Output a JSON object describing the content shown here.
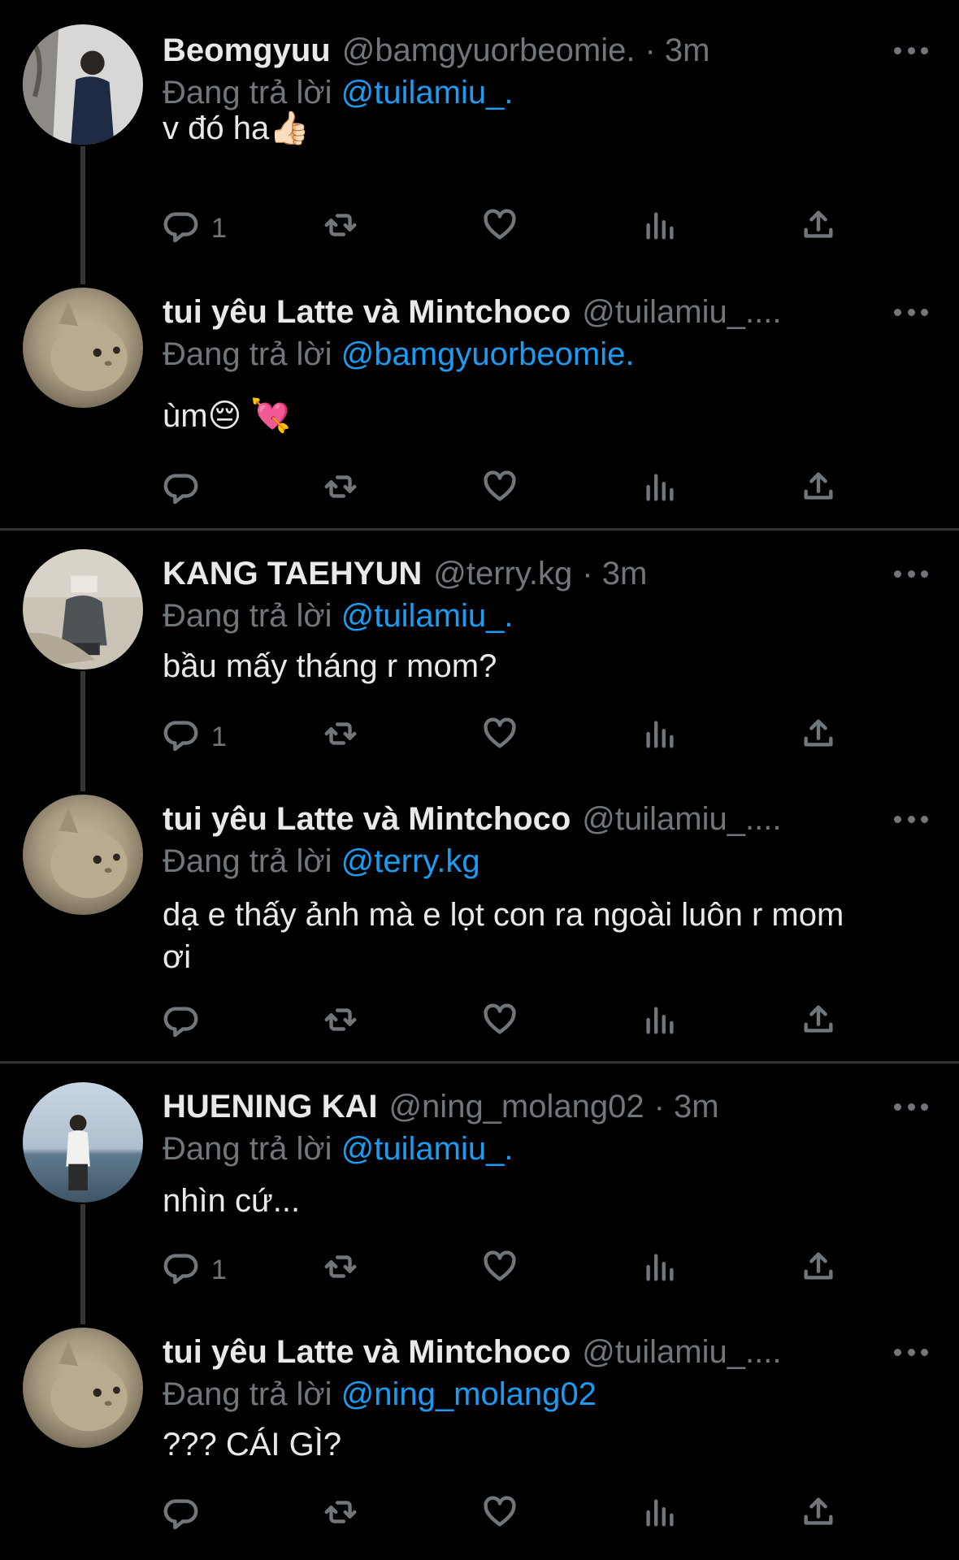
{
  "reply_prefix": "Đang trả lời",
  "colors": {
    "background": "#000000",
    "text": "#e7e9ea",
    "secondary": "#71767b",
    "link": "#1d9bf0",
    "divider": "#2f3336"
  },
  "tweets": [
    {
      "name": "Beomgyuu",
      "handle": "@bamgyuorbeomie.",
      "time": "· 3m",
      "reply_to": "@tuilamiu_.",
      "text": "v đó ha👍🏻",
      "reply_count": "1",
      "avatar": "photo-person-tree-avatar"
    },
    {
      "name": "tui yêu Latte và Mintchoco",
      "handle": "@tuilamiu_....",
      "time": "",
      "reply_to": "@bamgyuorbeomie.",
      "text": "ùm😔 💘",
      "reply_count": "",
      "avatar": "cat-avatar"
    },
    {
      "name": "KANG TAEHYUN",
      "handle": "@terry.kg",
      "time": "· 3m",
      "reply_to": "@tuilamiu_.",
      "text": "bầu mấy tháng r mom?",
      "reply_count": "1",
      "avatar": "photo-person-mirror-avatar"
    },
    {
      "name": "tui yêu Latte và Mintchoco",
      "handle": "@tuilamiu_....",
      "time": "",
      "reply_to": "@terry.kg",
      "text": "dạ e thấy ảnh mà e lọt con ra ngoài luôn r mom ơi",
      "reply_count": "",
      "avatar": "cat-avatar"
    },
    {
      "name": "HUENING KAI",
      "handle": "@ning_molang02",
      "time": "· 3m",
      "reply_to": "@tuilamiu_.",
      "text": "nhìn cứ...",
      "reply_count": "1",
      "avatar": "photo-person-beach-avatar"
    },
    {
      "name": "tui yêu Latte và Mintchoco",
      "handle": "@tuilamiu_....",
      "time": "",
      "reply_to": "@ning_molang02",
      "text": "??? CÁI GÌ?",
      "reply_count": "",
      "avatar": "cat-avatar"
    }
  ]
}
